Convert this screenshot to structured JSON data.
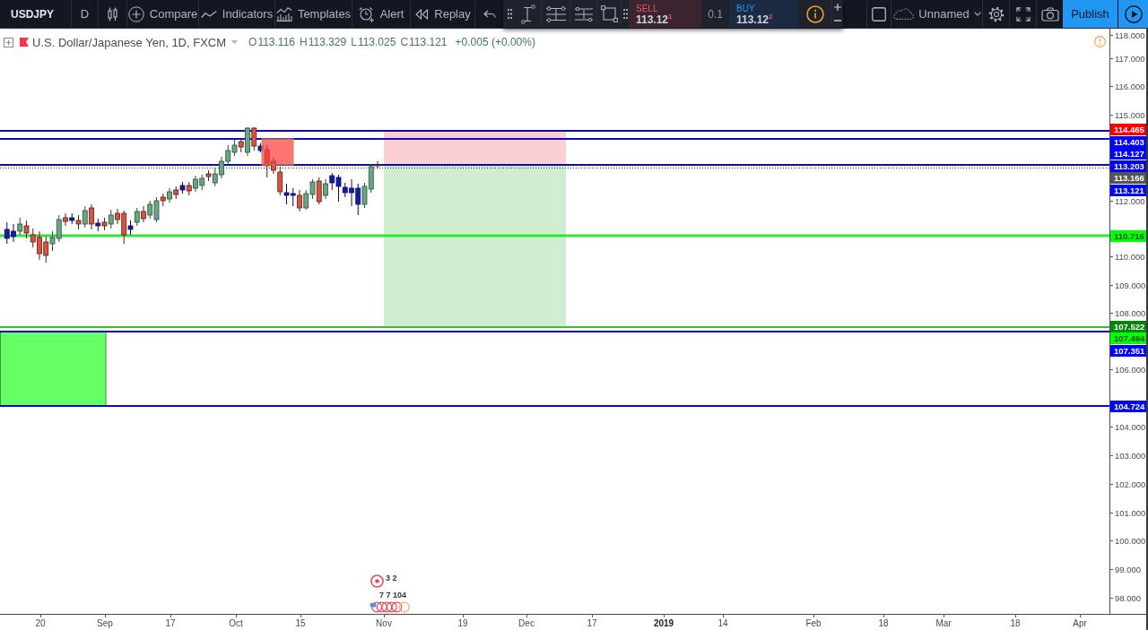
{
  "toolbar": {
    "symbol": "USDJPY",
    "interval": "D",
    "buttons": [
      {
        "kind": "compare",
        "label": "Compare"
      },
      {
        "kind": "indicators",
        "label": "Indicators"
      },
      {
        "kind": "templates",
        "label": "Templates"
      },
      {
        "kind": "alert",
        "label": "Alert"
      },
      {
        "kind": "replay",
        "label": "Replay"
      }
    ],
    "layout_name": "Unnamed",
    "publish": "Publish"
  },
  "trade_panel": {
    "sell": {
      "label": "SELL",
      "price": "113.12$^{1}$"
    },
    "quantity": "0.1",
    "buy": {
      "label": "BUY",
      "price": "113.12$^{2}$"
    }
  },
  "legend": {
    "title": "U.S. Dollar/Japanese Yen, 1D, FXCM",
    "ohlc": [
      {
        "key": "O",
        "value": "113.116"
      },
      {
        "key": "H",
        "value": "113.329"
      },
      {
        "key": "L",
        "value": "113.025"
      },
      {
        "key": "C",
        "value": "113.121"
      }
    ],
    "change": "+0.005 (+0.00%)"
  },
  "events": [
    "3 2",
    "7 7 104"
  ],
  "price_axis": {
    "ticks": [
      "118.000",
      "117.000",
      "116.000",
      "115.000",
      "112.000",
      "110.000",
      "109.000",
      "108.000",
      "106.000",
      "104.000",
      "103.000",
      "102.000",
      "101.000",
      "100.000",
      "99.000",
      "98.000"
    ],
    "markers": [
      {
        "text": "114.465",
        "color": "#ff0000"
      },
      {
        "text": "114.403",
        "color": "#0000ff"
      },
      {
        "text": "114.127",
        "color": "#0000ff"
      },
      {
        "text": "113.203",
        "color": "#0000ff"
      },
      {
        "text": "113.166",
        "color": "#555555"
      },
      {
        "text": "113.121",
        "color": "#0000ff"
      },
      {
        "text": "110.716",
        "color": "#00ff00"
      },
      {
        "text": "107.522",
        "color": "#008800"
      },
      {
        "text": "107.494",
        "color": "#00ff00"
      },
      {
        "text": "107.351",
        "color": "#0000ff"
      },
      {
        "text": "104.724",
        "color": "#0000ff"
      }
    ]
  },
  "time_axis": {
    "ticks": [
      {
        "label": "20",
        "kind": "date"
      },
      {
        "label": "Sep",
        "kind": "date"
      },
      {
        "label": "17",
        "kind": "date"
      },
      {
        "label": "Oct",
        "kind": "date"
      },
      {
        "label": "15",
        "kind": "date"
      },
      {
        "label": "Nov",
        "kind": "date"
      },
      {
        "label": "19",
        "kind": "date"
      },
      {
        "label": "Dec",
        "kind": "date"
      },
      {
        "label": "17",
        "kind": "date"
      },
      {
        "label": "2019",
        "kind": "year"
      },
      {
        "label": "14",
        "kind": "date"
      },
      {
        "label": "Feb",
        "kind": "date"
      },
      {
        "label": "18",
        "kind": "date"
      },
      {
        "label": "Mar",
        "kind": "date"
      },
      {
        "label": "18",
        "kind": "date"
      },
      {
        "label": "Apr",
        "kind": "date"
      }
    ]
  }
}
